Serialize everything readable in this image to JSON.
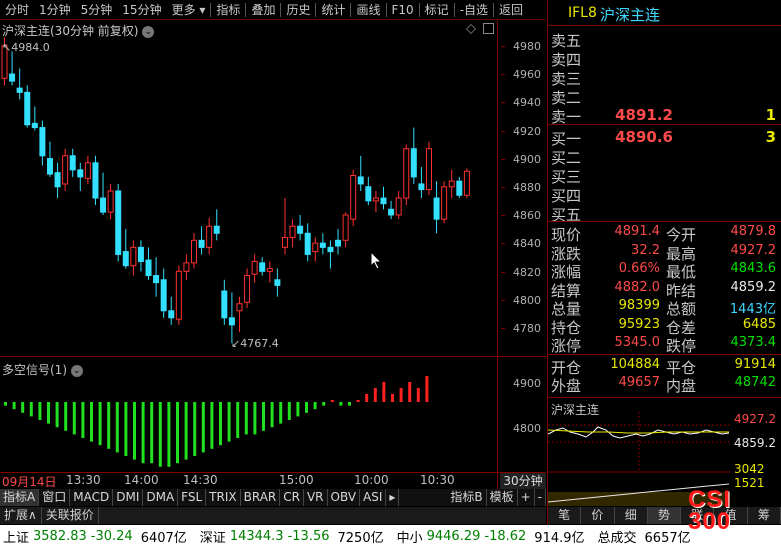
{
  "toolbar": {
    "items": [
      "分时",
      "1分钟",
      "5分钟",
      "15分钟",
      "更多 ▾",
      "指标",
      "叠加",
      "历史",
      "统计",
      "画线",
      "F10",
      "标记",
      "-自选",
      "返回"
    ]
  },
  "main_chart": {
    "title": "沪深主连(30分钟 前复权)",
    "title_icon": "chevron-down-icon",
    "high_label": "4984.0",
    "low_label": "4767.4",
    "y_ticks": [
      "4980",
      "4960",
      "4940",
      "4920",
      "4900",
      "4880",
      "4860",
      "4840",
      "4820",
      "4800",
      "4780"
    ],
    "date_label": "09月14日",
    "time_labels": [
      "13:30",
      "14:00",
      "14:30",
      "15:00",
      "10:00",
      "10:30"
    ],
    "period_label": "30分钟"
  },
  "indicator": {
    "title": "多空信号(1)",
    "title_icon": "chevron-down-icon",
    "y_ticks": [
      "4900",
      "4800"
    ]
  },
  "chart_data": {
    "type": "candlestick",
    "title": "沪深主连(30分钟 前复权)",
    "ylim": [
      4760,
      4990
    ],
    "candles": [
      [
        4955,
        4984,
        4950,
        4978
      ],
      [
        4958,
        4974,
        4950,
        4953
      ],
      [
        4948,
        4962,
        4940,
        4945
      ],
      [
        4945,
        4950,
        4920,
        4922
      ],
      [
        4923,
        4935,
        4918,
        4920
      ],
      [
        4920,
        4925,
        4893,
        4900
      ],
      [
        4898,
        4910,
        4885,
        4887
      ],
      [
        4888,
        4895,
        4870,
        4878
      ],
      [
        4880,
        4905,
        4875,
        4900
      ],
      [
        4900,
        4905,
        4885,
        4890
      ],
      [
        4890,
        4895,
        4875,
        4885
      ],
      [
        4884,
        4900,
        4880,
        4895
      ],
      [
        4895,
        4900,
        4865,
        4870
      ],
      [
        4870,
        4888,
        4858,
        4860
      ],
      [
        4860,
        4880,
        4855,
        4875
      ],
      [
        4875,
        4880,
        4825,
        4830
      ],
      [
        4832,
        4848,
        4820,
        4822
      ],
      [
        4822,
        4840,
        4815,
        4835
      ],
      [
        4835,
        4840,
        4818,
        4825
      ],
      [
        4826,
        4835,
        4812,
        4815
      ],
      [
        4815,
        4828,
        4800,
        4810
      ],
      [
        4812,
        4820,
        4785,
        4790
      ],
      [
        4790,
        4800,
        4780,
        4785
      ],
      [
        4784,
        4822,
        4780,
        4818
      ],
      [
        4818,
        4830,
        4812,
        4824
      ],
      [
        4824,
        4845,
        4820,
        4840
      ],
      [
        4840,
        4850,
        4830,
        4835
      ],
      [
        4835,
        4856,
        4830,
        4850
      ],
      [
        4850,
        4862,
        4840,
        4845
      ],
      [
        4804,
        4812,
        4780,
        4785
      ],
      [
        4785,
        4803,
        4767,
        4780
      ],
      [
        4790,
        4800,
        4775,
        4795
      ],
      [
        4796,
        4820,
        4792,
        4815
      ],
      [
        4816,
        4830,
        4810,
        4825
      ],
      [
        4824,
        4828,
        4815,
        4818
      ],
      [
        4818,
        4825,
        4810,
        4820
      ],
      [
        4812,
        4820,
        4800,
        4808
      ],
      [
        4835,
        4870,
        4830,
        4842
      ],
      [
        4842,
        4855,
        4835,
        4850
      ],
      [
        4850,
        4858,
        4840,
        4845
      ],
      [
        4845,
        4852,
        4825,
        4830
      ],
      [
        4832,
        4842,
        4825,
        4838
      ],
      [
        4838,
        4845,
        4830,
        4835
      ],
      [
        4835,
        4840,
        4820,
        4832
      ],
      [
        4840,
        4848,
        4830,
        4836
      ],
      [
        4840,
        4860,
        4835,
        4858
      ],
      [
        4855,
        4890,
        4850,
        4886
      ],
      [
        4885,
        4900,
        4875,
        4880
      ],
      [
        4878,
        4885,
        4865,
        4868
      ],
      [
        4868,
        4875,
        4860,
        4870
      ],
      [
        4870,
        4878,
        4862,
        4866
      ],
      [
        4862,
        4868,
        4855,
        4858
      ],
      [
        4858,
        4875,
        4855,
        4870
      ],
      [
        4870,
        4908,
        4865,
        4905
      ],
      [
        4905,
        4920,
        4880,
        4885
      ],
      [
        4880,
        4892,
        4870,
        4876
      ],
      [
        4876,
        4910,
        4872,
        4905
      ],
      [
        4870,
        4882,
        4845,
        4855
      ],
      [
        4855,
        4882,
        4852,
        4878
      ],
      [
        4878,
        4890,
        4870,
        4882
      ],
      [
        4882,
        4885,
        4870,
        4872
      ],
      [
        4872,
        4891,
        4870,
        4889
      ]
    ],
    "signal": [
      -1,
      -2,
      -3,
      -4,
      -5,
      -6,
      -7,
      -8,
      -9,
      -10,
      -11,
      -12,
      -13,
      -14,
      -15,
      -16,
      -17,
      -17,
      -18,
      -18,
      -17,
      -16,
      -15,
      -14,
      -13,
      -12,
      -11,
      -10,
      -9,
      -9,
      -8,
      -7,
      -6,
      -5,
      -4,
      -3,
      -2,
      -1,
      0,
      -1,
      -1,
      0,
      1,
      2,
      3,
      1,
      2,
      3,
      2,
      4
    ]
  },
  "right_panel": {
    "header_code": "IFL8",
    "header_name": "沪深主连",
    "sell": [
      {
        "label": "卖五",
        "price": "",
        "vol": ""
      },
      {
        "label": "卖四",
        "price": "",
        "vol": ""
      },
      {
        "label": "卖三",
        "price": "",
        "vol": ""
      },
      {
        "label": "卖二",
        "price": "",
        "vol": ""
      },
      {
        "label": "卖一",
        "price": "4891.2",
        "vol": "1"
      }
    ],
    "buy": [
      {
        "label": "买一",
        "price": "4890.6",
        "vol": "3"
      },
      {
        "label": "买二",
        "price": "",
        "vol": ""
      },
      {
        "label": "买三",
        "price": "",
        "vol": ""
      },
      {
        "label": "买四",
        "price": "",
        "vol": ""
      },
      {
        "label": "买五",
        "price": "",
        "vol": ""
      }
    ],
    "stats": [
      {
        "l1": "现价",
        "v1": "4891.4",
        "c1": "red",
        "l2": "今开",
        "v2": "4879.8",
        "c2": "red"
      },
      {
        "l1": "涨跌",
        "v1": "32.2",
        "c1": "red",
        "l2": "最高",
        "v2": "4927.2",
        "c2": "red"
      },
      {
        "l1": "涨幅",
        "v1": "0.66%",
        "c1": "red",
        "l2": "最低",
        "v2": "4843.6",
        "c2": "green"
      },
      {
        "l1": "结算",
        "v1": "4882.0",
        "c1": "red",
        "l2": "昨结",
        "v2": "4859.2",
        "c2": "white"
      },
      {
        "l1": "总量",
        "v1": "98399",
        "c1": "yellow",
        "l2": "总额",
        "v2": "1443亿",
        "c2": "cyan"
      },
      {
        "l1": "持仓",
        "v1": "95923",
        "c1": "yellow",
        "l2": "仓差",
        "v2": "6485",
        "c2": "yellow"
      },
      {
        "l1": "涨停",
        "v1": "5345.0",
        "c1": "red",
        "l2": "跌停",
        "v2": "4373.4",
        "c2": "green"
      }
    ],
    "stats2": [
      {
        "l1": "开仓",
        "v1": "104884",
        "c1": "yellow",
        "l2": "平仓",
        "v2": "91914",
        "c2": "yellow"
      },
      {
        "l1": "外盘",
        "v1": "49657",
        "c1": "red",
        "l2": "内盘",
        "v2": "48742",
        "c2": "green"
      }
    ],
    "mini_title": "沪深主连",
    "mini_prices": [
      "4927.2",
      "4859.2"
    ],
    "mini_vols": [
      "3042",
      "1521"
    ],
    "bottom_tabs": [
      "笔",
      "价",
      "细",
      "势",
      "联",
      "值",
      "筹"
    ],
    "logo": "CSI 300"
  },
  "tabs": [
    "指标A",
    "窗口",
    "MACD",
    "DMI",
    "DMA",
    "FSL",
    "TRIX",
    "BRAR",
    "CR",
    "VR",
    "OBV",
    "ASI",
    "▸",
    "指标B",
    "模板",
    "+",
    "-"
  ],
  "expand_row": [
    "扩展∧",
    "关联报价"
  ],
  "status_bar": [
    {
      "name": "上证",
      "price": "3582.83",
      "chg": "-30.24",
      "amt": "6407亿"
    },
    {
      "name": "深证",
      "price": "14344.3",
      "chg": "-13.56",
      "amt": "7250亿"
    },
    {
      "name": "中小",
      "price": "9446.29",
      "chg": "-18.62",
      "amt": "914.9亿"
    },
    {
      "name": "总成交",
      "price": "",
      "chg": "",
      "amt": "6657亿"
    }
  ]
}
